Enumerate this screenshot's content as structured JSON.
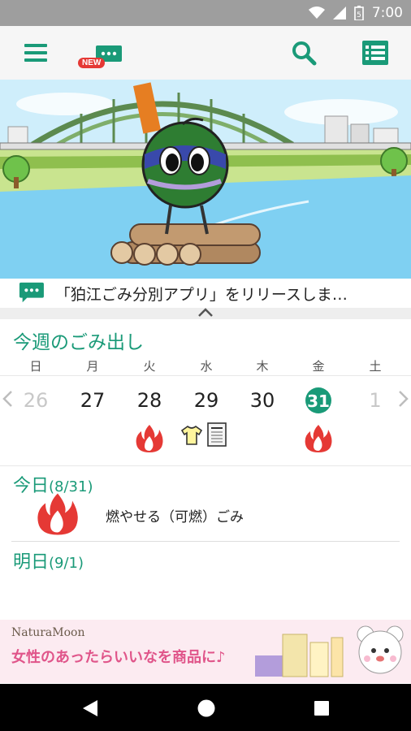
{
  "status_bar": {
    "time": "7:00",
    "battery_level": "5"
  },
  "app_bar": {
    "new_badge": "NEW"
  },
  "news": {
    "text": "「狛江ごみ分別アプリ」をリリースしま…"
  },
  "week": {
    "title": "今週のごみ出し",
    "weekdays": [
      "日",
      "月",
      "火",
      "水",
      "木",
      "金",
      "土"
    ],
    "dates": [
      "26",
      "27",
      "28",
      "29",
      "30",
      "31",
      "1"
    ],
    "today_index": 5
  },
  "today": {
    "label": "今日",
    "date": "(8/31)",
    "item": "燃やせる（可燃）ごみ"
  },
  "tomorrow": {
    "label": "明日",
    "date": "(9/1)"
  },
  "ad": {
    "brand": "NaturaMoon",
    "copy": "女性のあったらいいなを商品に♪"
  },
  "colors": {
    "accent": "#1a9a78",
    "fire": "#e53935"
  }
}
